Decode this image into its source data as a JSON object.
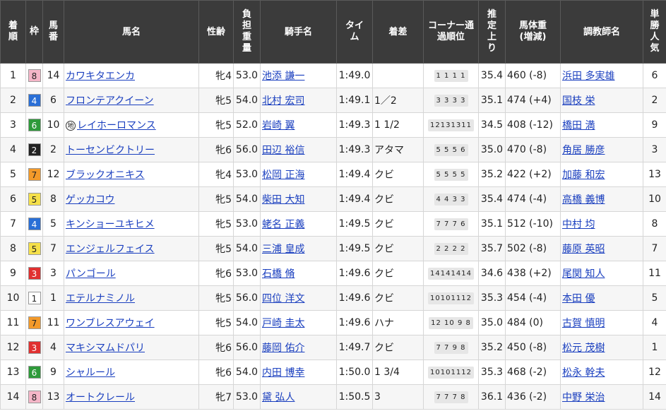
{
  "headers": {
    "rank": "着順",
    "waku": "枠",
    "umaban": "馬番",
    "horse": "馬名",
    "sexage": "性齢",
    "weight": "負担重量",
    "jockey": "騎手名",
    "time": "タイム",
    "margin": "着差",
    "corner": "コーナー通過順位",
    "last3f": "推定上り",
    "body_weight": "馬体重(増減)",
    "trainer": "調教師名",
    "pop": "単勝人気"
  },
  "waku_colors": {
    "1": {
      "bg": "#ffffff",
      "fg": "#222222"
    },
    "2": {
      "bg": "#222222",
      "fg": "#ffffff"
    },
    "3": {
      "bg": "#e03030",
      "fg": "#ffffff"
    },
    "4": {
      "bg": "#2a6fd6",
      "fg": "#ffffff"
    },
    "5": {
      "bg": "#f5e04a",
      "fg": "#222222"
    },
    "6": {
      "bg": "#2e9a3a",
      "fg": "#ffffff"
    },
    "7": {
      "bg": "#f39a2a",
      "fg": "#222222"
    },
    "8": {
      "bg": "#f5b6c8",
      "fg": "#222222"
    }
  },
  "chihou_mark": "地",
  "rows": [
    {
      "rank": "1",
      "waku": "8",
      "umaban": "14",
      "horse": "カワキタエンカ",
      "chihou": false,
      "sexage": "牝4",
      "weight": "53.0",
      "jockey": "池添 謙一",
      "time": "1:49.0",
      "margin": "",
      "corner": "1 1 1 1",
      "last3f": "35.4",
      "body_weight": "460 (-8)",
      "trainer": "浜田 多実雄",
      "pop": "6"
    },
    {
      "rank": "2",
      "waku": "4",
      "umaban": "6",
      "horse": "フロンテアクイーン",
      "chihou": false,
      "sexage": "牝5",
      "weight": "54.0",
      "jockey": "北村 宏司",
      "time": "1:49.1",
      "margin": "1／2",
      "corner": "3 3 3 3",
      "last3f": "35.1",
      "body_weight": "474 (+4)",
      "trainer": "国枝 栄",
      "pop": "2"
    },
    {
      "rank": "3",
      "waku": "6",
      "umaban": "10",
      "horse": "レイホーロマンス",
      "chihou": true,
      "sexage": "牝5",
      "weight": "52.0",
      "jockey": "岩崎 翼",
      "time": "1:49.3",
      "margin": "1 1/2",
      "corner": "12131311",
      "last3f": "34.5",
      "body_weight": "408 (-12)",
      "trainer": "橋田 満",
      "pop": "9"
    },
    {
      "rank": "4",
      "waku": "2",
      "umaban": "2",
      "horse": "トーセンビクトリー",
      "chihou": false,
      "sexage": "牝6",
      "weight": "56.0",
      "jockey": "田辺 裕信",
      "time": "1:49.3",
      "margin": "アタマ",
      "corner": "5 5 5 6",
      "last3f": "35.0",
      "body_weight": "470 (-8)",
      "trainer": "角居 勝彦",
      "pop": "3"
    },
    {
      "rank": "5",
      "waku": "7",
      "umaban": "12",
      "horse": "ブラックオニキス",
      "chihou": false,
      "sexage": "牝4",
      "weight": "53.0",
      "jockey": "松岡 正海",
      "time": "1:49.4",
      "margin": "クビ",
      "corner": "5 5 5 5",
      "last3f": "35.2",
      "body_weight": "422 (+2)",
      "trainer": "加藤 和宏",
      "pop": "13"
    },
    {
      "rank": "6",
      "waku": "5",
      "umaban": "8",
      "horse": "ゲッカコウ",
      "chihou": false,
      "sexage": "牝5",
      "weight": "54.0",
      "jockey": "柴田 大知",
      "time": "1:49.4",
      "margin": "クビ",
      "corner": "4 4 3 3",
      "last3f": "35.4",
      "body_weight": "474 (-4)",
      "trainer": "高橋 義博",
      "pop": "10"
    },
    {
      "rank": "7",
      "waku": "4",
      "umaban": "5",
      "horse": "キンショーユキヒメ",
      "chihou": false,
      "sexage": "牝5",
      "weight": "53.0",
      "jockey": "蛯名 正義",
      "time": "1:49.5",
      "margin": "クビ",
      "corner": "7 7 7 6",
      "last3f": "35.1",
      "body_weight": "512 (-10)",
      "trainer": "中村 均",
      "pop": "8"
    },
    {
      "rank": "8",
      "waku": "5",
      "umaban": "7",
      "horse": "エンジェルフェイス",
      "chihou": false,
      "sexage": "牝5",
      "weight": "54.0",
      "jockey": "三浦 皇成",
      "time": "1:49.5",
      "margin": "クビ",
      "corner": "2 2 2 2",
      "last3f": "35.7",
      "body_weight": "502 (-8)",
      "trainer": "藤原 英昭",
      "pop": "7"
    },
    {
      "rank": "9",
      "waku": "3",
      "umaban": "3",
      "horse": "パンゴール",
      "chihou": false,
      "sexage": "牝6",
      "weight": "53.0",
      "jockey": "石橋 脩",
      "time": "1:49.6",
      "margin": "クビ",
      "corner": "14141414",
      "last3f": "34.6",
      "body_weight": "438 (+2)",
      "trainer": "尾関 知人",
      "pop": "11"
    },
    {
      "rank": "10",
      "waku": "1",
      "umaban": "1",
      "horse": "エテルナミノル",
      "chihou": false,
      "sexage": "牝5",
      "weight": "56.0",
      "jockey": "四位 洋文",
      "time": "1:49.6",
      "margin": "クビ",
      "corner": "10101112",
      "last3f": "35.3",
      "body_weight": "454 (-4)",
      "trainer": "本田 優",
      "pop": "5"
    },
    {
      "rank": "11",
      "waku": "7",
      "umaban": "11",
      "horse": "ワンブレスアウェイ",
      "chihou": false,
      "sexage": "牝5",
      "weight": "54.0",
      "jockey": "戸崎 圭太",
      "time": "1:49.6",
      "margin": "ハナ",
      "corner": "12 10 9 8",
      "last3f": "35.0",
      "body_weight": "484 (0)",
      "trainer": "古賀 慎明",
      "pop": "4"
    },
    {
      "rank": "12",
      "waku": "3",
      "umaban": "4",
      "horse": "マキシマムドパリ",
      "chihou": false,
      "sexage": "牝6",
      "weight": "56.0",
      "jockey": "藤岡 佑介",
      "time": "1:49.7",
      "margin": "クビ",
      "corner": "7 7 9 8",
      "last3f": "35.2",
      "body_weight": "450 (-8)",
      "trainer": "松元 茂樹",
      "pop": "1"
    },
    {
      "rank": "13",
      "waku": "6",
      "umaban": "9",
      "horse": "シャルール",
      "chihou": false,
      "sexage": "牝6",
      "weight": "54.0",
      "jockey": "内田 博幸",
      "time": "1:50.0",
      "margin": "1 3/4",
      "corner": "10101112",
      "last3f": "35.3",
      "body_weight": "468 (-2)",
      "trainer": "松永 幹夫",
      "pop": "12"
    },
    {
      "rank": "14",
      "waku": "8",
      "umaban": "13",
      "horse": "オートクレール",
      "chihou": false,
      "sexage": "牝7",
      "weight": "53.0",
      "jockey": "黛 弘人",
      "time": "1:50.5",
      "margin": "3",
      "corner": "7 7 7 8",
      "last3f": "36.1",
      "body_weight": "436 (-2)",
      "trainer": "中野 栄治",
      "pop": "14"
    }
  ]
}
